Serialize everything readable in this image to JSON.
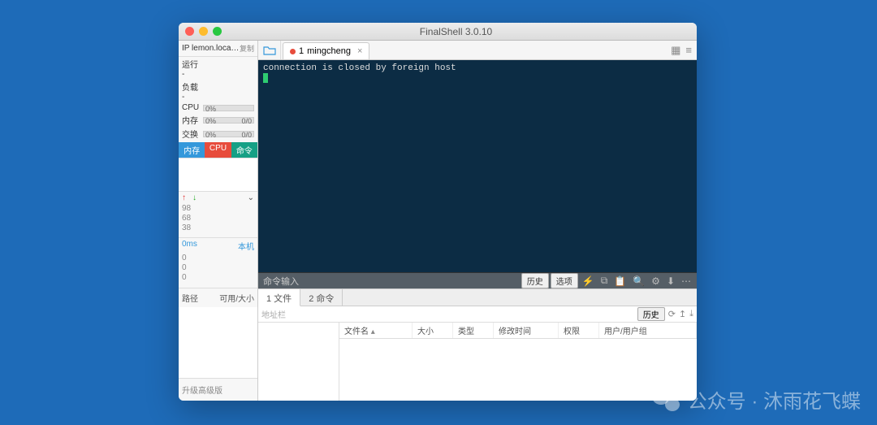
{
  "window": {
    "title": "FinalShell 3.0.10"
  },
  "sidebar": {
    "ip_label": "IP lemon.local.qq.c...",
    "copy_label": "复制",
    "run_label": "运行 -",
    "load_label": "负载 -",
    "metrics": {
      "cpu_label": "CPU",
      "cpu_pct": "0%",
      "mem_label": "内存",
      "mem_pct": "0%",
      "mem_ratio": "0/0",
      "swap_label": "交换",
      "swap_pct": "0%",
      "swap_ratio": "0/0"
    },
    "tabs": {
      "mem": "内存",
      "cpu": "CPU",
      "cmd": "命令"
    },
    "updown": {
      "up": "↑",
      "down": "↓",
      "menu": "⌄"
    },
    "nums": [
      "98",
      "68",
      "38"
    ],
    "ping_ms": "0ms",
    "ping_host": "本机",
    "ping_vals": [
      "0",
      "0",
      "0"
    ],
    "path_label": "路径",
    "size_label": "可用/大小",
    "upgrade": "升级高级版"
  },
  "tab": {
    "index": "1",
    "name": "mingcheng"
  },
  "terminal": {
    "line1": "connection is closed by foreign host"
  },
  "cmdbar": {
    "label": "命令输入",
    "history_btn": "历史",
    "options_btn": "选项"
  },
  "bottom_tabs": {
    "files": "1 文件",
    "cmds": "2 命令"
  },
  "addrbar": {
    "placeholder": "地址栏",
    "history_btn": "历史"
  },
  "file_cols": {
    "name": "文件名",
    "size": "大小",
    "type": "类型",
    "mtime": "修改时间",
    "perm": "权限",
    "owner": "用户/用户组"
  },
  "watermark": {
    "text": "公众号 · 沐雨花飞蝶"
  }
}
